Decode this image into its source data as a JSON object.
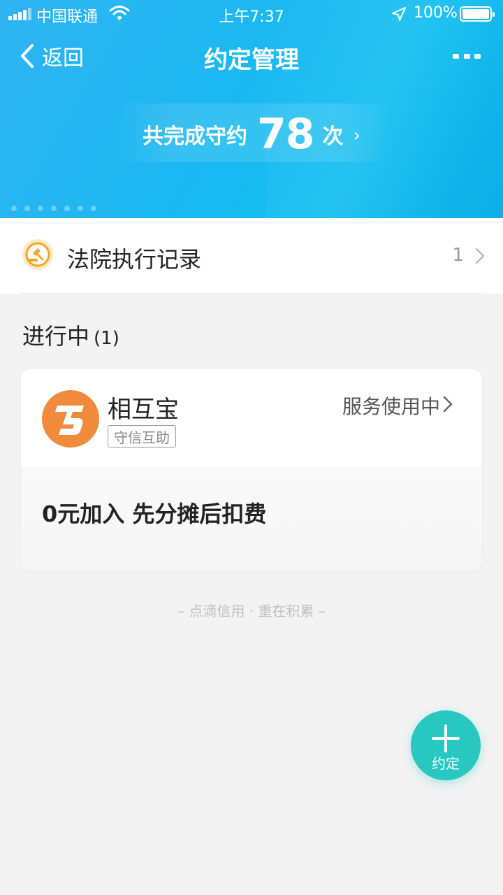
{
  "status_bar": {
    "carrier": "中国联通",
    "time": "上午7:37",
    "battery_percent": "100%"
  },
  "nav": {
    "back_label": "返回",
    "title": "约定管理"
  },
  "summary": {
    "prefix": "共完成守约",
    "count": "78",
    "unit": "次"
  },
  "court_record": {
    "label": "法院执行记录",
    "count": "1"
  },
  "section": {
    "title": "进行中",
    "count": "(1)"
  },
  "card": {
    "name": "相互宝",
    "tag": "守信互助",
    "status": "服务使用中",
    "description": "0元加入 先分摊后扣费"
  },
  "footer_note": "– 点滴信用 · 重在积累 –",
  "fab": {
    "label": "约定"
  },
  "colors": {
    "header": "#1bb8f1",
    "fab": "#28c8c0",
    "logo": "#f08a3c",
    "court_icon": "#f5a623"
  }
}
